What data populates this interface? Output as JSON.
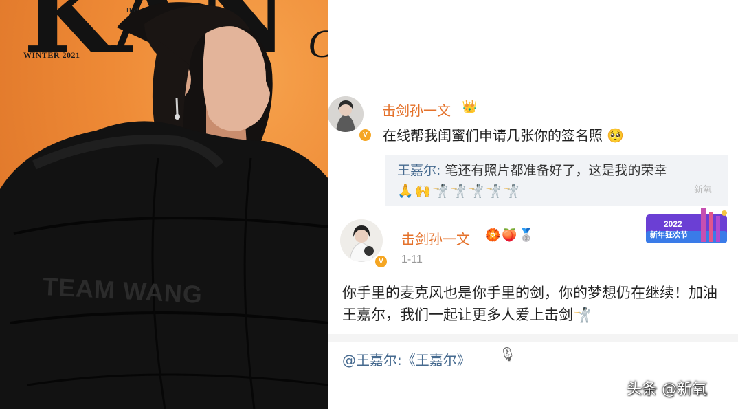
{
  "cover": {
    "masthead": "KAN",
    "masthead_small": "ma",
    "masthead_script": "C",
    "issue": "WINTER 2021",
    "jacket_print": "TEAM WANG"
  },
  "thread": {
    "comment1": {
      "avatar": "avatar-fencer-photo",
      "username": "击剑孙一文",
      "badge": "crown-icon",
      "text": "在线帮我闺蜜们申请几张你的签名照",
      "emoji": "🥺"
    },
    "reply": {
      "name": "王嘉尔:",
      "text": " 笔还有照片都准备好了，这是我的荣幸",
      "emojis": "🙏🙌🤺🤺🤺🤺🤺"
    },
    "xinyang_watermark": "新氧",
    "comment2": {
      "avatar": "avatar-fencer-portrait",
      "username": "击剑孙一文",
      "badges": "🏵️🍑🥈",
      "date": "1-11",
      "banner_year": "2022",
      "banner_label": "新年狂欢节",
      "text": "你手里的麦克风也是你手里的剑，你的梦想仍在继续！加油王嘉尔，我们一起让更多人爱上击剑🤺"
    },
    "mention": "@王嘉尔:《王嘉尔》",
    "mic_icon": "🎙"
  },
  "footer": {
    "watermark": "头条 @新氧"
  },
  "colors": {
    "cover_orange": "#ee8a36",
    "username_orange": "#e4712a",
    "link_blue": "#466a8f",
    "reply_bg": "#f1f3f6"
  }
}
